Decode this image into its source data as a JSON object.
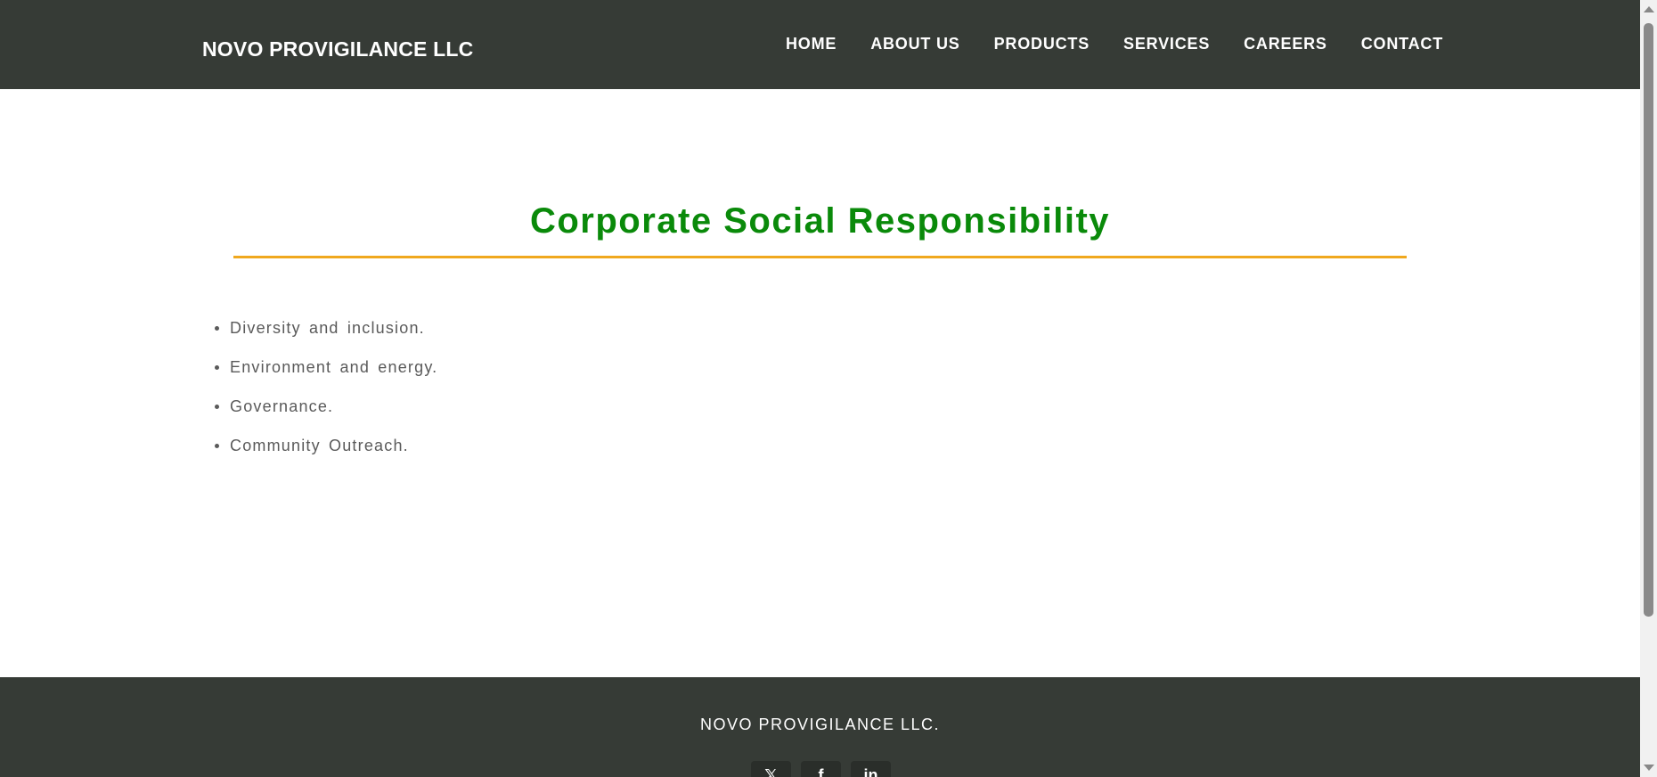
{
  "header": {
    "brand": "NOVO PROVIGILANCE LLC",
    "nav": [
      {
        "label": "HOME"
      },
      {
        "label": "ABOUT US"
      },
      {
        "label": "PRODUCTS"
      },
      {
        "label": "SERVICES"
      },
      {
        "label": "CAREERS"
      },
      {
        "label": "CONTACT"
      }
    ]
  },
  "main": {
    "title": "Corporate Social Responsibility",
    "items": [
      "Diversity and inclusion.",
      "Environment and energy.",
      "Governance.",
      "Community Outreach."
    ]
  },
  "footer": {
    "company": "NOVO PROVIGILANCE LLC.",
    "social": [
      {
        "icon": "x-icon",
        "glyph": "𝕏"
      },
      {
        "icon": "facebook-icon",
        "glyph": "f"
      },
      {
        "icon": "linkedin-icon",
        "glyph": "in"
      }
    ]
  },
  "colors": {
    "header_bg": "#363b36",
    "title_green": "#0a8a0a",
    "rule_orange": "#f0a81e",
    "body_text": "#5a5a5a"
  }
}
